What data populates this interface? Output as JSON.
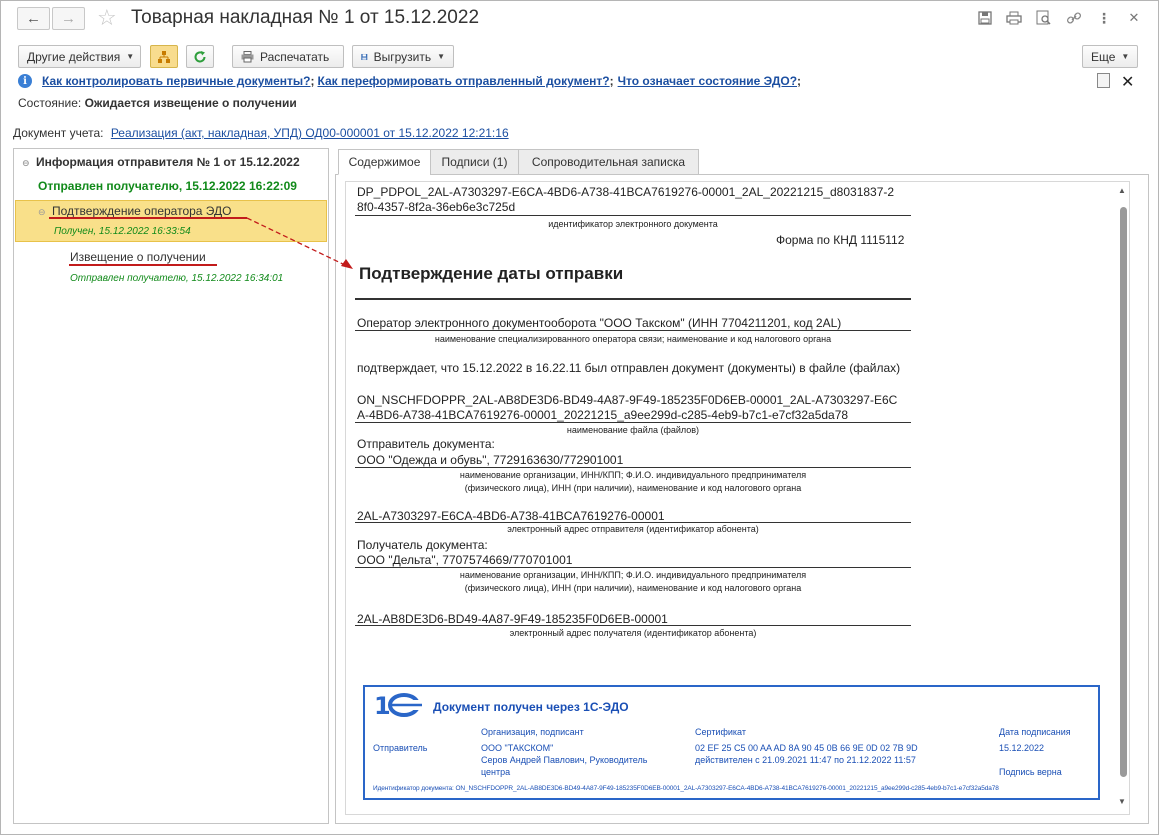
{
  "window": {
    "title": "Товарная накладная № 1 от 15.12.2022",
    "nav_back": "←",
    "nav_forward": "→"
  },
  "toolbar": {
    "other_actions": "Другие действия",
    "print": "Распечатать",
    "export": "Выгрузить",
    "more": "Еще"
  },
  "help": {
    "link1": "Как контролировать первичные документы?",
    "link2": "Как переформировать отправленный документ?",
    "link3": "Что означает состояние ЭДО?",
    "sep": ";"
  },
  "state": {
    "label": "Состояние:",
    "value": "Ожидается извещение о получении"
  },
  "doc_ref": {
    "label": "Документ учета:",
    "value": "Реализация (акт, накладная, УПД) ОД00-000001 от 15.12.2022 12:21:16"
  },
  "tree": {
    "root": "Информация отправителя № 1 от 15.12.2022",
    "root_status": "Отправлен получателю, 15.12.2022 16:22:09",
    "item1": "Подтверждение оператора ЭДО",
    "item1_status": "Получен, 15.12.2022 16:33:54",
    "item2": "Извещение о получении",
    "item2_status": "Отправлен получателю, 15.12.2022 16:34:01"
  },
  "tabs": [
    "Содержимое",
    "Подписи (1)",
    "Сопроводительная записка"
  ],
  "document": {
    "id_line1": "DP_PDPOL_2AL-A7303297-E6CA-4BD6-A738-41BCA7619276-00001_2AL_20221215_d8031837-2",
    "id_line2": "8f0-4357-8f2a-36eb6e3c725d",
    "id_caption": "идентификатор электронного документа",
    "form": "Форма по КНД 1115112",
    "heading": "Подтверждение даты отправки",
    "operator": "Оператор электронного документооборота \"ООО Такском\" (ИНН 7704211201, код 2AL)",
    "operator_caption": "наименование специализированного оператора связи; наименование и код налогового органа",
    "confirms": "подтверждает, что 15.12.2022 в 16.22.11 был отправлен документ (документы) в файле (файлах)",
    "file_line1": "ON_NSCHFDOPPR_2AL-AB8DE3D6-BD49-4A87-9F49-185235F0D6EB-00001_2AL-A7303297-E6C",
    "file_line2": "A-4BD6-A738-41BCA7619276-00001_20221215_a9ee299d-c285-4eb9-b7c1-e7cf32a5da78",
    "file_caption": "наименование файла (файлов)",
    "sender_label": "Отправитель документа:",
    "sender": "ООО \"Одежда и обувь\", 7729163630/772901001",
    "org_caption1": "наименование организации, ИНН/КПП; Ф.И.О. индивидуального предпринимателя",
    "org_caption2": "(физического лица), ИНН (при наличии), наименование и код налогового органа",
    "sender_addr": "2AL-A7303297-E6CA-4BD6-A738-41BCA7619276-00001",
    "sender_addr_caption": "электронный адрес отправителя (идентификатор абонента)",
    "receiver_label": "Получатель документа:",
    "receiver": "ООО \"Дельта\", 7707574669/770701001",
    "receiver_addr": "2AL-AB8DE3D6-BD49-4A87-9F49-185235F0D6EB-00001",
    "receiver_addr_caption": "электронный адрес получателя (идентификатор абонента)"
  },
  "stamp": {
    "title": "Документ получен через 1С-ЭДО",
    "col_org": "Организация, подписант",
    "col_cert": "Сертификат",
    "col_date": "Дата подписания",
    "row_label": "Отправитель",
    "org": "ООО \"ТАКСКОМ\"",
    "signer1": "Серов Андрей Павлович, Руководитель",
    "signer2": "центра",
    "cert": "02 EF 25 C5 00 AA AD 8A 90 45 0B 66 9E 0D 02 7B 9D",
    "cert_valid": "действителен с 21.09.2021 11:47 по 21.12.2022 11:57",
    "date": "15.12.2022",
    "sig_ok": "Подпись верна",
    "doc_id": "Идентификатор документа: ON_NSCHFDOPPR_2AL-AB8DE3D6-BD49-4A87-9F49-185235F0D6EB-00001_2AL-A7303297-E6CA-4BD6-A738-41BCA7619276-00001_20221215_a9ee299d-c285-4eb9-b7c1-e7cf32a5da78"
  },
  "colors": {
    "link": "#1c4fa1",
    "green": "#118a1a",
    "selection": "#f9e08a",
    "stamp_blue": "#2a66c8",
    "annotation_red": "#c21b1b"
  }
}
